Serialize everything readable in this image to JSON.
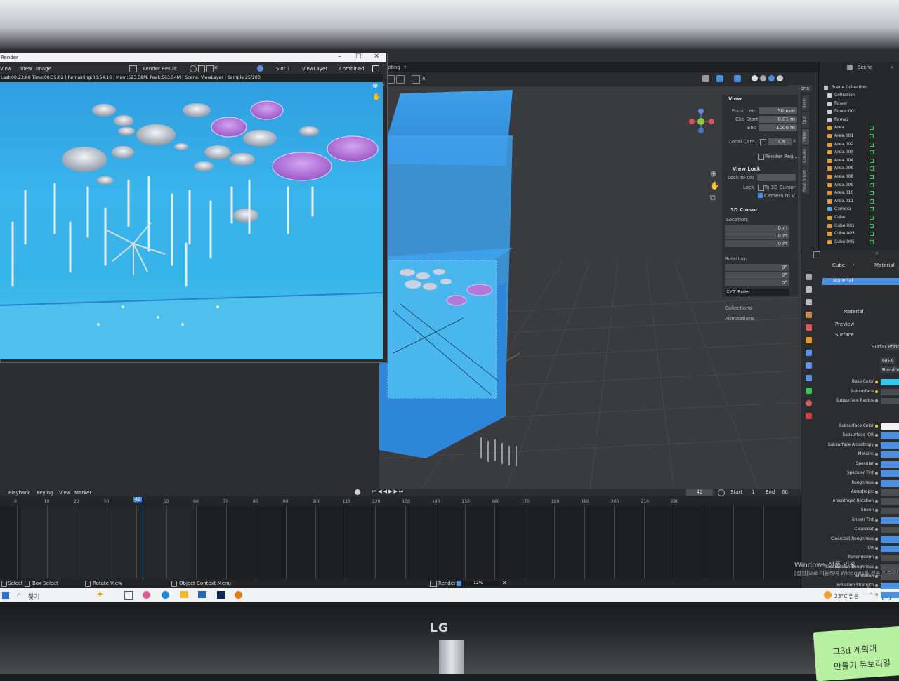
{
  "monitor": {
    "brand": "LG"
  },
  "note": {
    "line1": "그3d 계획대",
    "line2": "만들기 듀토리얼"
  },
  "render_window": {
    "title": "Render",
    "menus": [
      "View",
      "View",
      "Image"
    ],
    "image_name": "Render Result",
    "slot": "Slot 1",
    "layer": "ViewLayer",
    "pass": "Combined",
    "status": "Last:00:23.60 Time:00:35.02 | Remaining:03:54.16 | Mem:523.58M, Peak:563.54M | Scene, ViewLayer | Sample 25/200"
  },
  "workspace": {
    "tab": "ripting",
    "add": "+"
  },
  "viewport": {
    "options_label": "Options"
  },
  "npanel": {
    "tabs": [
      "Item",
      "Tool",
      "View",
      "Create",
      "Real Snow"
    ],
    "view": {
      "header": "View",
      "focal_label": "Focal Len...",
      "focal_value": "50 mm",
      "clip_start_label": "Clip Start",
      "clip_start_value": "0.01 m",
      "end_label": "End",
      "end_value": "1000 m",
      "local_cam_label": "Local Cam...",
      "local_cam_value": "Ca...",
      "render_region": "Render Regi..."
    },
    "view_lock": {
      "header": "View Lock",
      "lock_to_label": "Lock to Ob",
      "lock_label": "Lock",
      "to_cursor": "To 3D Cursor",
      "camera_to_view": "Camera to V..."
    },
    "cursor": {
      "header": "3D Cursor",
      "location_label": "Location:",
      "x_label": "X",
      "x_value": "0 m",
      "y_label": "Y",
      "y_value": "0 m",
      "z_label": "Z",
      "z_value": "0 m",
      "rotation_label": "Rotation:",
      "rx_label": "X",
      "rx_value": "0°",
      "ry_label": "Y",
      "ry_value": "0°",
      "rz_label": "Z",
      "rz_value": "0°",
      "mode": "XYZ Euler"
    },
    "collections": "Collections",
    "annotations": "Annotations"
  },
  "outliner": {
    "scene": "Scene",
    "root": "Scene Collection",
    "items": [
      "Collection",
      "flower",
      "flower.001",
      "flame2",
      "Area",
      "Area.001",
      "Area.002",
      "Area.003",
      "Area.004",
      "Area.006",
      "Area.008",
      "Area.009",
      "Area.010",
      "Area.011",
      "Camera",
      "Cube",
      "Cube.001",
      "Cube.003",
      "Cube.005"
    ]
  },
  "properties": {
    "breadcrumb_object": "Cube",
    "breadcrumb_material": "Material",
    "slot_name": "Material",
    "material_name": "Material",
    "preview": "Preview",
    "surface": "Surface",
    "surface_label": "Surface",
    "surface_value": "Princ",
    "distribution": "GGX",
    "sss_method": "Random",
    "inputs": [
      "Base Color",
      "Subsurface",
      "Subsurface Radius",
      "Subsurface Color",
      "Subsurface IOR",
      "Subsurface Anisotropy",
      "Metallic",
      "Specular",
      "Specular Tint",
      "Roughness",
      "Anisotropic",
      "Anisotropic Rotation",
      "Sheen",
      "Sheen Tint",
      "Clearcoat",
      "Clearcoat Roughness",
      "IOR",
      "Transmission",
      "Transmission Roughness",
      "Emission",
      "Emission Strength",
      "Alpha"
    ]
  },
  "timeline": {
    "menus": [
      "Playback",
      "Keying",
      "View",
      "Marker"
    ],
    "current_frame": "42",
    "start_label": "Start",
    "start_value": "1",
    "end_label": "End",
    "end_value": "60",
    "ticks": [
      "0",
      "10",
      "20",
      "30",
      "40",
      "50",
      "60",
      "70",
      "80",
      "90",
      "100",
      "110",
      "120",
      "130",
      "140",
      "150",
      "160",
      "170",
      "180",
      "190",
      "200",
      "210",
      "220",
      "230",
      "240",
      "250"
    ]
  },
  "statusbar": {
    "select": "Select",
    "box_select": "Box Select",
    "rotate_view": "Rotate View",
    "context_menu": "Object Context Menu",
    "render_label": "Render",
    "progress_text": "12%",
    "watermark1": "Windows 정품 인증",
    "watermark2": "[설정]으로 이동하여 Windows를 정품 인증합니다."
  },
  "progress": {
    "fraction": 0.12
  },
  "taskbar": {
    "search_placeholder": "찾기",
    "weather": "23°C 맑음"
  },
  "colors": {
    "blender_blue": "#4a8fe0",
    "render_sky": "#3ab4ec",
    "purple_disc": "#b07ad8",
    "active_green": "#3fc05a"
  },
  "chart_data": {
    "type": "table",
    "title": "",
    "ticks": [
      "0",
      "10",
      "20",
      "30",
      "40",
      "50",
      "60",
      "70",
      "80",
      "90",
      "100",
      "110",
      "120",
      "130",
      "140",
      "150",
      "160",
      "170",
      "180",
      "190",
      "200",
      "210",
      "220",
      "230",
      "240",
      "250"
    ],
    "current_frame": 42,
    "frame_range": [
      1,
      60
    ]
  }
}
